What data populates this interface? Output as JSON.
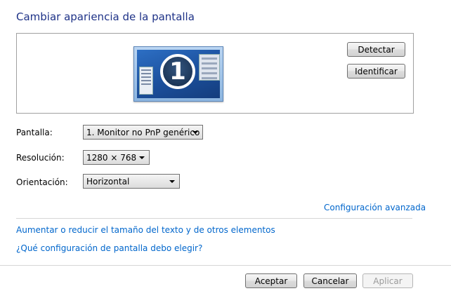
{
  "page": {
    "title": "Cambiar apariencia de la pantalla"
  },
  "preview": {
    "monitor_number": "1",
    "detect_label": "Detectar",
    "identify_label": "Identificar"
  },
  "settings": {
    "display_label": "Pantalla:",
    "display_value": "1. Monitor no PnP genérico",
    "resolution_label": "Resolución:",
    "resolution_value": "1280 × 768",
    "orientation_label": "Orientación:",
    "orientation_value": "Horizontal"
  },
  "links": {
    "advanced": "Configuración avanzada",
    "text_size": "Aumentar o reducir el tamaño del texto y de otros elementos",
    "which_settings": "¿Qué configuración de pantalla debo elegir?"
  },
  "footer": {
    "ok_label": "Aceptar",
    "cancel_label": "Cancelar",
    "apply_label": "Aplicar"
  }
}
